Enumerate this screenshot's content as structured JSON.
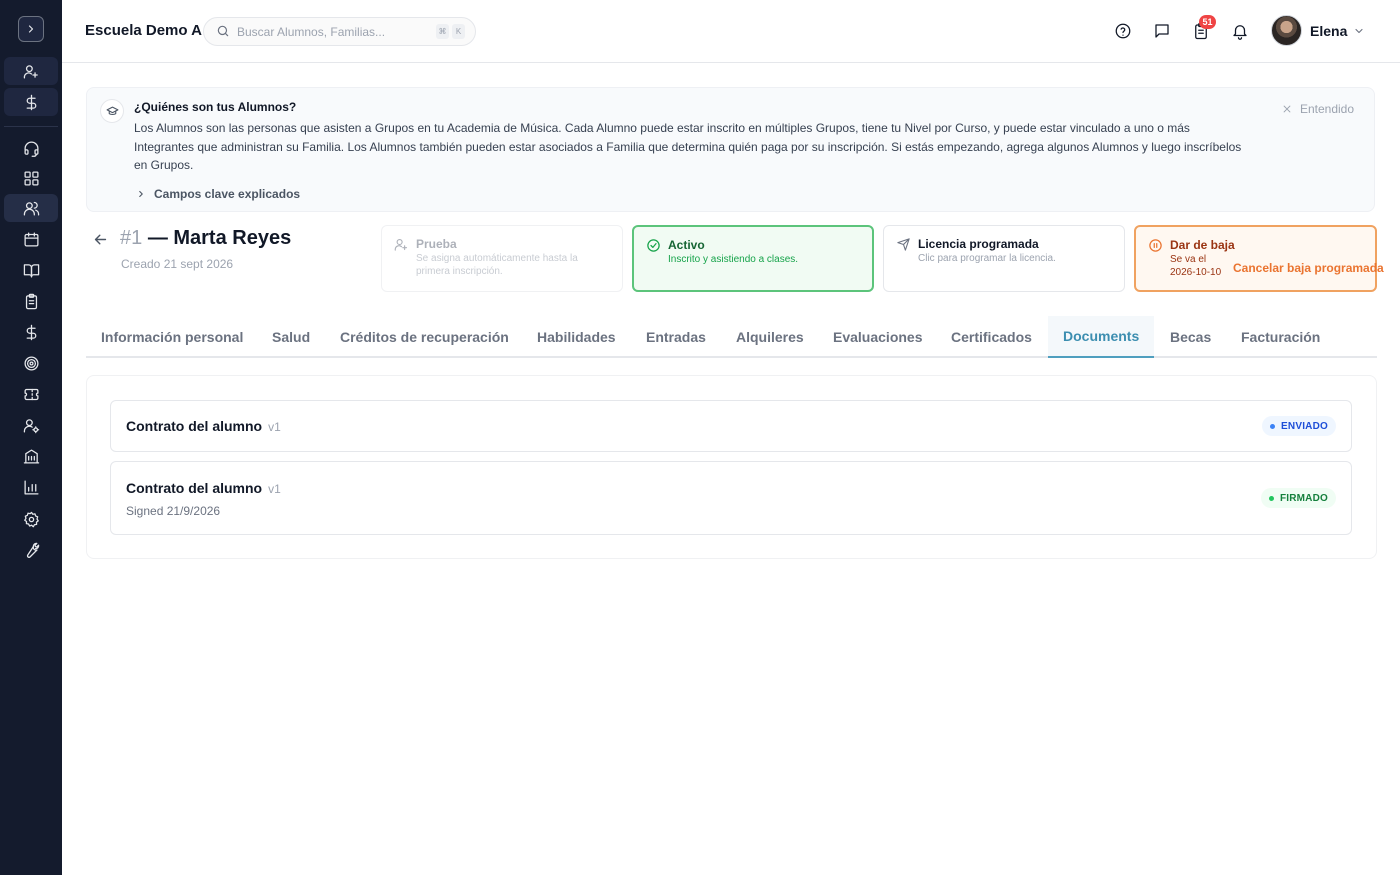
{
  "sidebar": {
    "toggle_icon": "chevron-right-icon",
    "quick_actions": [
      "user-plus-icon",
      "dollar-icon"
    ],
    "nav_items": [
      {
        "icon": "headset-icon",
        "name": "support"
      },
      {
        "icon": "dashboard-icon",
        "name": "dashboard"
      },
      {
        "icon": "users-icon",
        "name": "students",
        "active": true
      },
      {
        "icon": "calendar-icon",
        "name": "calendar"
      },
      {
        "icon": "book-icon",
        "name": "courses"
      },
      {
        "icon": "clipboard-icon",
        "name": "attendance"
      },
      {
        "icon": "dollar-icon",
        "name": "billing"
      },
      {
        "icon": "target-icon",
        "name": "goals"
      },
      {
        "icon": "ticket-icon",
        "name": "tickets"
      },
      {
        "icon": "user-settings-icon",
        "name": "staff"
      },
      {
        "icon": "building-icon",
        "name": "locations"
      },
      {
        "icon": "bar-chart-icon",
        "name": "reports"
      },
      {
        "icon": "gear-icon",
        "name": "settings"
      },
      {
        "icon": "wrench-icon",
        "name": "tools"
      }
    ]
  },
  "header": {
    "school_name": "Escuela Demo A",
    "search": {
      "placeholder": "Buscar Alumnos, Familias...",
      "shortcut": [
        "⌘",
        "K"
      ]
    },
    "notifications_count": "51",
    "user_name": "Elena"
  },
  "info_banner": {
    "title": "¿Quiénes son tus Alumnos?",
    "body": "Los Alumnos son las personas que asisten a Grupos en tu Academia de Música. Cada Alumno puede estar inscrito en múltiples Grupos, tiene tu Nivel por Curso, y puede estar vinculado a uno o más Integrantes que administran su Familia. Los Alumnos también pueden estar asociados a Familia que determina quién paga por su inscripción. Si estás empezando, agrega algunos Alumnos y luego inscríbelos en Grupos.",
    "dismiss_label": "Entendido",
    "expand_label": "Campos clave explicados"
  },
  "student": {
    "number": "#1",
    "name": "— Marta Reyes",
    "created": "Creado 21 sept 2026"
  },
  "status_cards": [
    {
      "title": "Prueba",
      "desc": "Se asigna automáticamente hasta la primera inscripción.",
      "state": "muted"
    },
    {
      "title": "Activo",
      "desc": "Inscrito y asistiendo a clases.",
      "state": "active"
    },
    {
      "title": "Licencia programada",
      "desc": "Clic para programar la licencia.",
      "state": "default"
    },
    {
      "title": "Dar de baja",
      "desc": "Se va el 2026-10-10",
      "state": "warn"
    }
  ],
  "cancel_link": "Cancelar baja programada",
  "tabs": [
    {
      "label": "Información personal"
    },
    {
      "label": "Salud"
    },
    {
      "label": "Créditos de recuperación"
    },
    {
      "label": "Habilidades"
    },
    {
      "label": "Entradas"
    },
    {
      "label": "Alquileres"
    },
    {
      "label": "Evaluaciones"
    },
    {
      "label": "Certificados"
    },
    {
      "label": "Documents",
      "selected": true
    },
    {
      "label": "Becas"
    },
    {
      "label": "Facturación"
    }
  ],
  "documents": [
    {
      "name": "Contrato del alumno",
      "version": "v1",
      "subtitle": "",
      "status": "ENVIADO",
      "status_color": "#1d4ed8"
    },
    {
      "name": "Contrato del alumno",
      "version": "v1",
      "subtitle": "Signed 21/9/2026",
      "status": "FIRMADO",
      "status_color": "#15803d"
    }
  ],
  "colors": {
    "sidebar_bg": "#141b2d",
    "accent_tab": "#3c8eb0",
    "active_green": "#5cc47b",
    "warn_orange": "#ea7430",
    "badge_red": "#ef4444"
  }
}
